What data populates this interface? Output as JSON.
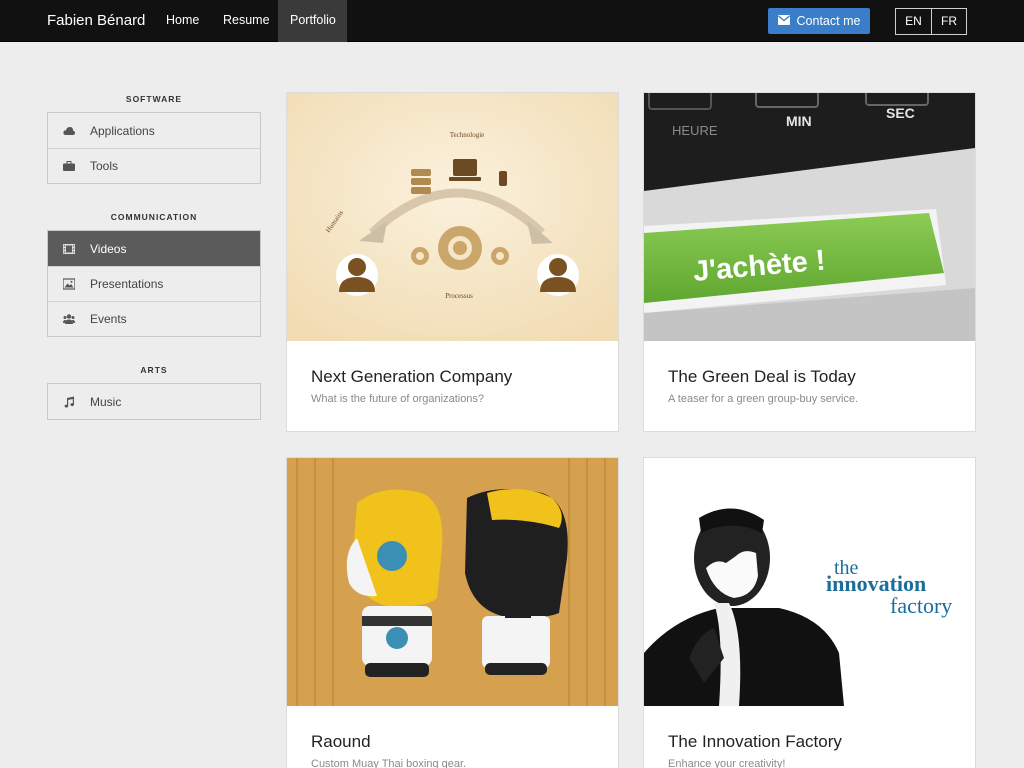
{
  "navbar": {
    "brand": "Fabien Bénard",
    "links": [
      "Home",
      "Resume",
      "Portfolio"
    ],
    "active_link": "Portfolio",
    "contact_label": "Contact me",
    "languages": [
      "EN",
      "FR"
    ]
  },
  "sidebar": {
    "sections": [
      {
        "title": "SOFTWARE",
        "items": [
          {
            "label": "Applications",
            "icon": "cloud-icon"
          },
          {
            "label": "Tools",
            "icon": "briefcase-icon"
          }
        ]
      },
      {
        "title": "COMMUNICATION",
        "items": [
          {
            "label": "Videos",
            "icon": "film-icon",
            "active": true
          },
          {
            "label": "Presentations",
            "icon": "image-icon"
          },
          {
            "label": "Events",
            "icon": "users-icon"
          }
        ]
      },
      {
        "title": "ARTS",
        "items": [
          {
            "label": "Music",
            "icon": "music-icon"
          }
        ]
      }
    ]
  },
  "cards": [
    {
      "title": "Next Generation Company",
      "subtitle": "What is the future of organizations?",
      "image_labels": {
        "top": "Technologie",
        "left": "Humains",
        "bottom": "Processus"
      }
    },
    {
      "title": "The Green Deal is Today",
      "subtitle": "A teaser for a green group-buy service.",
      "image_labels": {
        "keys": [
          "HEURE",
          "MIN",
          "SEC"
        ],
        "button": "J'achète !"
      }
    },
    {
      "title": "Raound",
      "subtitle": "Custom Muay Thai boxing gear."
    },
    {
      "title": "The Innovation Factory",
      "subtitle": "Enhance your creativity!",
      "image_labels": {
        "line1": "the",
        "line2": "innovation",
        "line3": "factory"
      }
    }
  ],
  "colors": {
    "navbar_bg": "#111111",
    "accent": "#3a7dc8",
    "active_menu": "#5b5b5b",
    "page_bg": "#ededed",
    "green_button": "#7cc04a"
  }
}
